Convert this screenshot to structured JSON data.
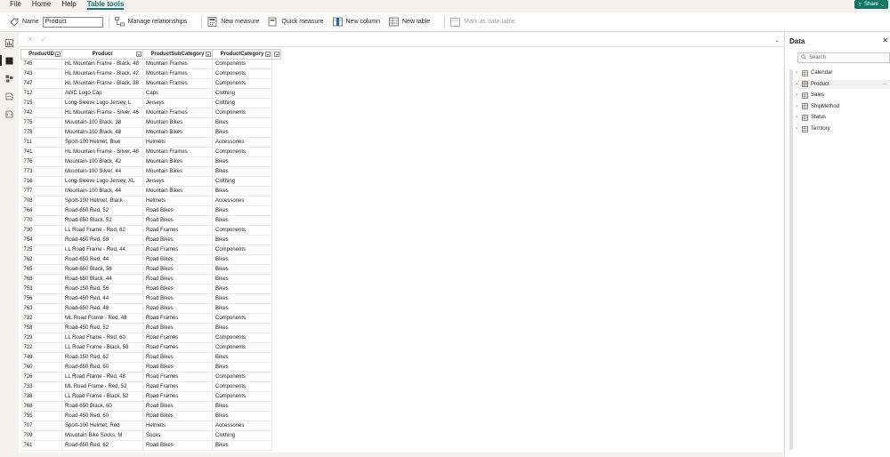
{
  "menu": {
    "items": [
      {
        "label": "File"
      },
      {
        "label": "Home"
      },
      {
        "label": "Help"
      },
      {
        "label": "Table tools"
      }
    ],
    "share_label": "Share"
  },
  "ribbon": {
    "name_label": "Name",
    "name_value": "Product",
    "manage_relationships": "Manage relationships",
    "new_measure": "New measure",
    "quick_measure": "Quick measure",
    "new_column": "New column",
    "new_table": "New table",
    "mark_as_date_table": "Mark as date table"
  },
  "table": {
    "columns": [
      "ProductID",
      "Product",
      "ProductSubCategory",
      "ProductCategory"
    ],
    "rows": [
      [
        "745",
        "HL Mountain Frame - Black, 48",
        "Mountain Frames",
        "Components"
      ],
      [
        "743",
        "HL Mountain Frame - Black, 42",
        "Mountain Frames",
        "Components"
      ],
      [
        "747",
        "HL Mountain Frame - Black, 38",
        "Mountain Frames",
        "Components"
      ],
      [
        "712",
        "AWC Logo Cap",
        "Caps",
        "Clothing"
      ],
      [
        "715",
        "Long-Sleeve Logo Jersey, L",
        "Jerseys",
        "Clothing"
      ],
      [
        "742",
        "HL Mountain Frame - Silver, 46",
        "Mountain Frames",
        "Components"
      ],
      [
        "775",
        "Mountain-100 Black, 38",
        "Mountain Bikes",
        "Bikes"
      ],
      [
        "778",
        "Mountain-100 Black, 48",
        "Mountain Bikes",
        "Bikes"
      ],
      [
        "711",
        "Sport-100 Helmet, Blue",
        "Helmets",
        "Accessories"
      ],
      [
        "741",
        "HL Mountain Frame - Silver, 48",
        "Mountain Frames",
        "Components"
      ],
      [
        "776",
        "Mountain-100 Black, 42",
        "Mountain Bikes",
        "Bikes"
      ],
      [
        "773",
        "Mountain-100 Silver, 44",
        "Mountain Bikes",
        "Bikes"
      ],
      [
        "716",
        "Long-Sleeve Logo Jersey, XL",
        "Jerseys",
        "Clothing"
      ],
      [
        "777",
        "Mountain-100 Black, 44",
        "Mountain Bikes",
        "Bikes"
      ],
      [
        "708",
        "Sport-100 Helmet, Black",
        "Helmets",
        "Accessories"
      ],
      [
        "764",
        "Road-650 Red, 52",
        "Road Bikes",
        "Bikes"
      ],
      [
        "770",
        "Road-650 Black, 52",
        "Road Bikes",
        "Bikes"
      ],
      [
        "730",
        "LL Road Frame - Red, 62",
        "Road Frames",
        "Components"
      ],
      [
        "754",
        "Road-450 Red, 58",
        "Road Bikes",
        "Bikes"
      ],
      [
        "725",
        "LL Road Frame - Red, 44",
        "Road Frames",
        "Components"
      ],
      [
        "762",
        "Road-650 Red, 44",
        "Road Bikes",
        "Bikes"
      ],
      [
        "765",
        "Road-650 Black, 58",
        "Road Bikes",
        "Bikes"
      ],
      [
        "768",
        "Road-650 Black, 44",
        "Road Bikes",
        "Bikes"
      ],
      [
        "753",
        "Road-150 Red, 56",
        "Road Bikes",
        "Bikes"
      ],
      [
        "756",
        "Road-450 Red, 44",
        "Road Bikes",
        "Bikes"
      ],
      [
        "763",
        "Road-650 Red, 48",
        "Road Bikes",
        "Bikes"
      ],
      [
        "732",
        "ML Road Frame - Red, 48",
        "Road Frames",
        "Components"
      ],
      [
        "758",
        "Road-450 Red, 52",
        "Road Bikes",
        "Bikes"
      ],
      [
        "729",
        "LL Road Frame - Red, 60",
        "Road Frames",
        "Components"
      ],
      [
        "722",
        "LL Road Frame - Black, 58",
        "Road Frames",
        "Components"
      ],
      [
        "749",
        "Road-150 Red, 62",
        "Road Bikes",
        "Bikes"
      ],
      [
        "760",
        "Road-650 Red, 60",
        "Road Bikes",
        "Bikes"
      ],
      [
        "726",
        "LL Road Frame - Red, 48",
        "Road Frames",
        "Components"
      ],
      [
        "733",
        "ML Road Frame - Red, 52",
        "Road Frames",
        "Components"
      ],
      [
        "738",
        "LL Road Frame - Black, 52",
        "Road Frames",
        "Components"
      ],
      [
        "766",
        "Road-650 Black, 60",
        "Road Bikes",
        "Bikes"
      ],
      [
        "755",
        "Road-450 Red, 60",
        "Road Bikes",
        "Bikes"
      ],
      [
        "707",
        "Sport-100 Helmet, Red",
        "Helmets",
        "Accessories"
      ],
      [
        "709",
        "Mountain Bike Socks, M",
        "Socks",
        "Clothing"
      ],
      [
        "761",
        "Road-650 Red, 62",
        "Road Bikes",
        "Bikes"
      ]
    ]
  },
  "data_pane": {
    "title": "Data",
    "search_placeholder": "Search",
    "tables": [
      {
        "label": "Calendar"
      },
      {
        "label": "Product"
      },
      {
        "label": "Sales"
      },
      {
        "label": "ShipMethod"
      },
      {
        "label": "Status"
      },
      {
        "label": "Territory"
      }
    ],
    "selected_index": 1
  },
  "colors": {
    "accent": "#117865",
    "background": "#f3f2f1",
    "border": "#e1dfdd"
  }
}
